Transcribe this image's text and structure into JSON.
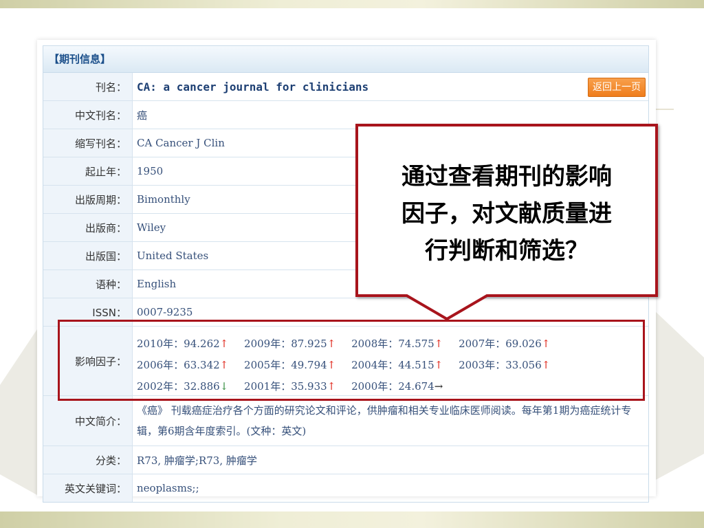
{
  "panel": {
    "header": "【期刊信息】",
    "back_button": "返回上一页",
    "rows": [
      {
        "label": "刊名：",
        "value": "CA: a cancer journal for clinicians"
      },
      {
        "label": "中文刊名：",
        "value": "癌"
      },
      {
        "label": "缩写刊名：",
        "value": "CA Cancer J Clin"
      },
      {
        "label": "起止年：",
        "value": "1950"
      },
      {
        "label": "出版周期：",
        "value": "Bimonthly"
      },
      {
        "label": "出版商：",
        "value": "Wiley"
      },
      {
        "label": "出版国：",
        "value": "United States"
      },
      {
        "label": "语种：",
        "value": "English"
      },
      {
        "label": "ISSN：",
        "value": "0007-9235"
      }
    ],
    "impact": {
      "label": "影响因子：",
      "items": [
        {
          "text": "2010年：94.262",
          "arrow": "↑"
        },
        {
          "text": "2009年：87.925",
          "arrow": "↑"
        },
        {
          "text": "2008年：74.575",
          "arrow": "↑"
        },
        {
          "text": "2007年：69.026",
          "arrow": "↑"
        },
        {
          "text": "2006年：63.342",
          "arrow": "↑"
        },
        {
          "text": "2005年：49.794",
          "arrow": "↑"
        },
        {
          "text": "2004年：44.515",
          "arrow": "↑"
        },
        {
          "text": "2003年：33.056",
          "arrow": "↑"
        },
        {
          "text": "2002年：32.886",
          "arrow": "↓"
        },
        {
          "text": "2001年：35.933",
          "arrow": "↑"
        },
        {
          "text": "2000年：24.674",
          "arrow": "→"
        }
      ]
    },
    "intro": {
      "label": "中文简介：",
      "value": "《癌》 刊载癌症治疗各个方面的研究论文和评论，供肿瘤和相关专业临床医师阅读。每年第1期为癌症统计专辑，第6期含年度索引。(文种：英文)"
    },
    "category": {
      "label": "分类：",
      "value": "R73, 肿瘤学;R73, 肿瘤学"
    },
    "keywords": {
      "label": "英文关键词：",
      "value": "neoplasms;;"
    }
  },
  "callout": {
    "line1": "通过查看期刊的影响",
    "line2": "因子，对文献质量进",
    "line3": "行判断和筛选？"
  },
  "colors": {
    "accent_red": "#a8141c",
    "button_orange": "#ef7d1c",
    "link_blue": "#1b4f8a"
  }
}
